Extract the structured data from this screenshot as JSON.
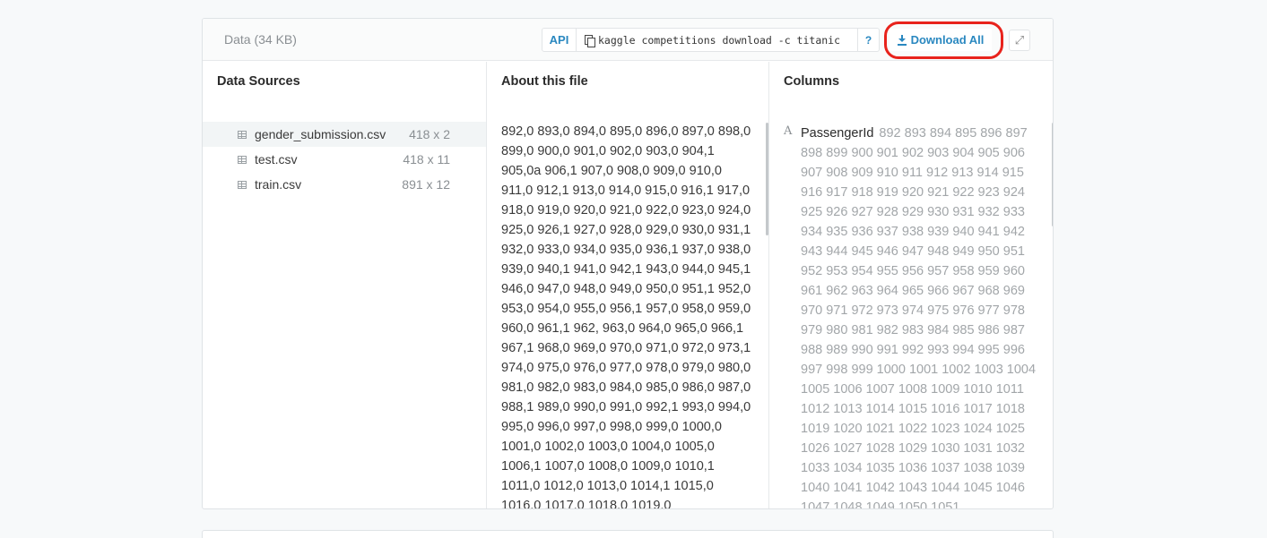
{
  "header": {
    "title": "Data (34 KB)",
    "api_label": "API",
    "command": "kaggle competitions download -c titanic",
    "help_label": "?",
    "download_all_label": "Download All",
    "icons": {
      "copy": "copy-icon",
      "download": "download-icon",
      "expand": "expand-icon"
    },
    "highlight_color": "#e8231c",
    "accent_color": "#2a88c0"
  },
  "sources": {
    "title": "Data Sources",
    "items": [
      {
        "name": "gender_submission.csv",
        "dims": "418 x 2",
        "active": true
      },
      {
        "name": "test.csv",
        "dims": "418 x 11",
        "active": false
      },
      {
        "name": "train.csv",
        "dims": "891 x 12",
        "active": false
      }
    ]
  },
  "about": {
    "title": "About this file",
    "text": "892,0 893,0 894,0 895,0 896,0 897,0 898,0 899,0 900,0 901,0 902,0 903,0 904,1 905,0a 906,1 907,0 908,0 909,0 910,0 911,0 912,1 913,0 914,0 915,0 916,1 917,0 918,0 919,0 920,0 921,0 922,0 923,0 924,0 925,0 926,1 927,0 928,0 929,0 930,0 931,1 932,0 933,0 934,0 935,0 936,1 937,0 938,0 939,0 940,1 941,0 942,1 943,0 944,0 945,1 946,0 947,0 948,0 949,0 950,0 951,1 952,0 953,0 954,0 955,0 956,1 957,0 958,0 959,0 960,0 961,1 962, 963,0 964,0 965,0 966,1 967,1 968,0 969,0 970,0 971,0 972,0 973,1 974,0 975,0 976,0 977,0 978,0 979,0 980,0 981,0 982,0 983,0 984,0 985,0 986,0 987,0 988,1 989,0 990,0 991,0 992,1 993,0 994,0 995,0 996,0 997,0 998,0 999,0 1000,0 1001,0 1002,0 1003,0 1004,0 1005,0 1006,1 1007,0 1008,0 1009,0 1010,1 1011,0 1012,0 1013,0 1014,1 1015,0 1016,0 1017,0 1018,0 1019,0"
  },
  "columns": {
    "title": "Columns",
    "type_icon": "A",
    "items": [
      {
        "name": "PassengerId",
        "values": "892 893 894 895 896 897 898 899 900 901 902 903 904 905 906 907 908 909 910 911 912 913 914 915 916 917 918 919 920 921 922 923 924 925 926 927 928 929 930 931 932 933 934 935 936 937 938 939 940 941 942 943 944 945 946 947 948 949 950 951 952 953 954 955 956 957 958 959 960 961 962 963 964 965 966 967 968 969 970 971 972 973 974 975 976 977 978 979 980 981 982 983 984 985 986 987 988 989 990 991 992 993 994 995 996 997 998 999 1000 1001 1002 1003 1004 1005 1006 1007 1008 1009 1010 1011 1012 1013 1014 1015 1016 1017 1018 1019 1020 1021 1022 1023 1024 1025 1026 1027 1028 1029 1030 1031 1032 1033 1034 1035 1036 1037 1038 1039 1040 1041 1042 1043 1044 1045 1046 1047 1048 1049 1050 1051"
      }
    ]
  }
}
